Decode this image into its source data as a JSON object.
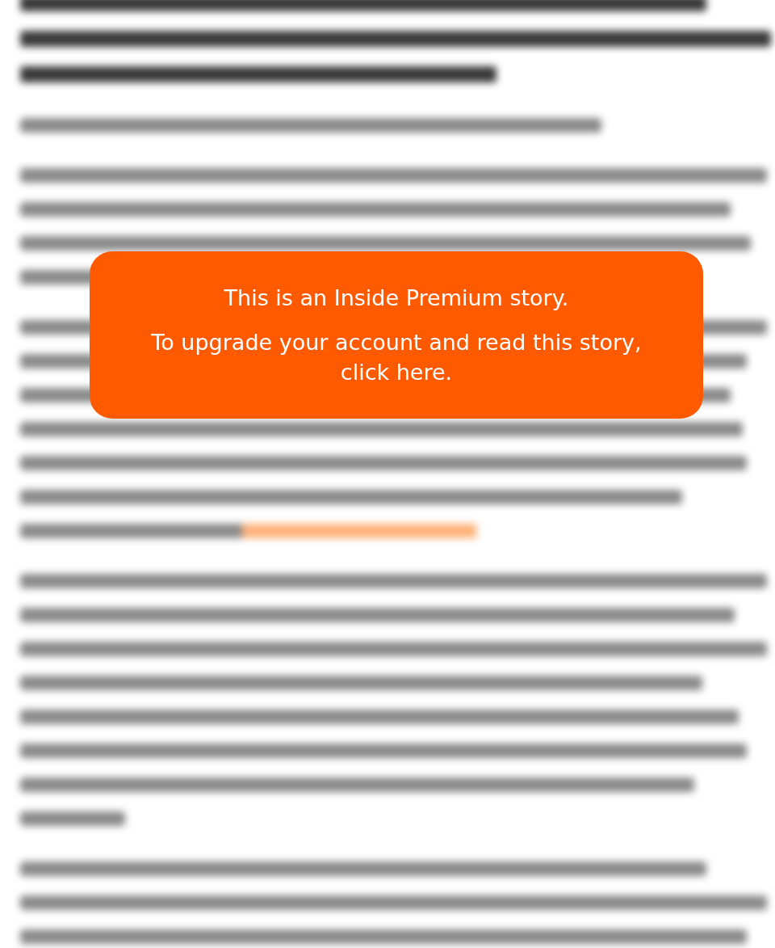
{
  "paywall": {
    "title": "This is an Inside Premium story.",
    "message": "To upgrade your account and read this story, click here."
  }
}
